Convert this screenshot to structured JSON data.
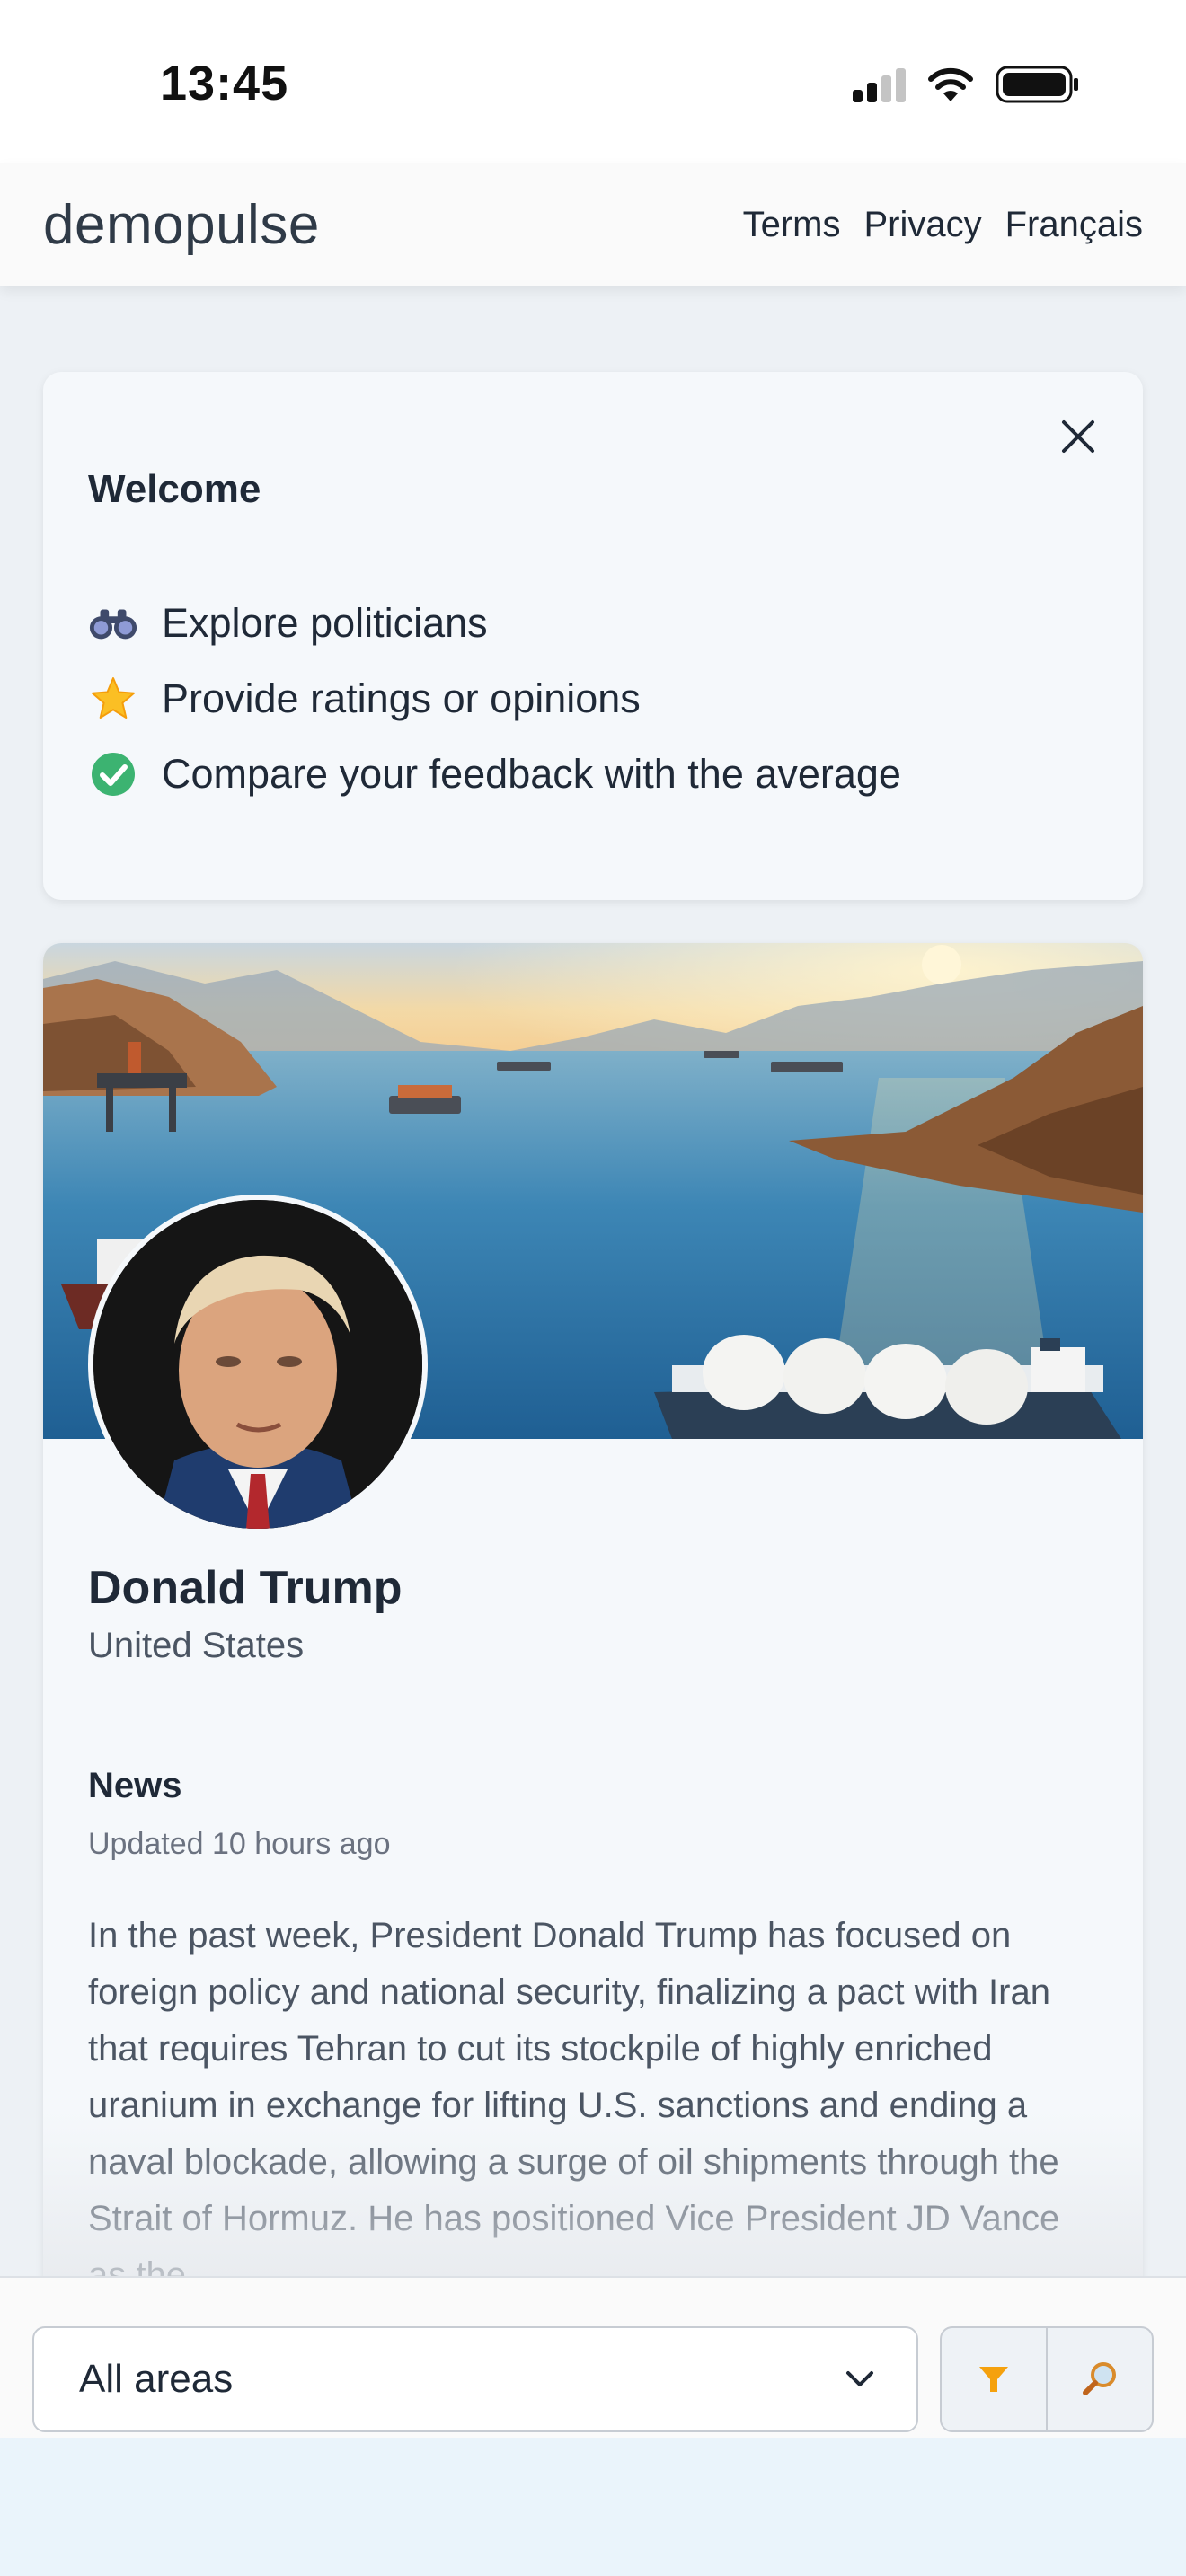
{
  "status_bar": {
    "time": "13:45",
    "signal_icon": "cellular-signal-icon",
    "wifi_icon": "wifi-icon",
    "battery_icon": "battery-icon"
  },
  "navbar": {
    "brand": "demopulse",
    "links": [
      "Terms",
      "Privacy",
      "Français"
    ]
  },
  "welcome": {
    "title": "Welcome",
    "close_icon": "close-icon",
    "items": [
      {
        "icon": "binoculars-icon",
        "text": "Explore politicians"
      },
      {
        "icon": "star-icon",
        "text": "Provide ratings or opinions"
      },
      {
        "icon": "check-circle-icon",
        "text": "Compare your feedback with the average"
      }
    ]
  },
  "profile": {
    "banner_icon": "strait-seascape-banner",
    "avatar_icon": "politician-portrait",
    "name": "Donald Trump",
    "country": "United States",
    "news": {
      "heading": "News",
      "updated": "Updated 10 hours ago",
      "body": "In the past week, President Donald Trump has focused on foreign policy and national security, finalizing a pact with Iran that requires Tehran to cut its stockpile of highly enriched uranium in exchange for lifting U.S. sanctions and ending a naval blockade, allowing a surge of oil shipments through the Strait of Hormuz. He has positioned Vice President JD Vance as the"
    }
  },
  "bottom_bar": {
    "area_select": {
      "selected": "All areas",
      "chevron_icon": "chevron-down-icon"
    },
    "filter_icon": "filter-icon",
    "search_icon": "search-icon"
  },
  "colors": {
    "accent_orange": "#f5a10d",
    "check_green": "#3cb371",
    "star_yellow": "#fbbf24",
    "page_bg": "#edf1f5"
  }
}
